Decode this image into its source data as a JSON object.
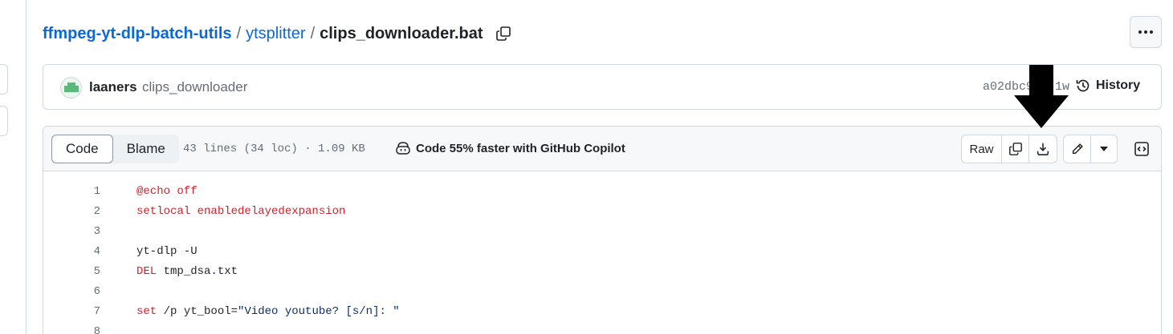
{
  "breadcrumb": {
    "repo": "ffmpeg-yt-dlp-batch-utils",
    "sep1": "/",
    "folder": "ytsplitter",
    "sep2": "/",
    "file": "clips_downloader.bat"
  },
  "commit": {
    "author": "laaners",
    "message": "clips_downloader",
    "hash": "a02dbc9 · 1w",
    "history_label": "History"
  },
  "file_header": {
    "code_tab": "Code",
    "blame_tab": "Blame",
    "meta": "43 lines (34 loc) · 1.09 KB",
    "copilot": "Code 55% faster with GitHub Copilot",
    "raw_label": "Raw"
  },
  "code_lines": [
    {
      "n": "1"
    },
    {
      "n": "2"
    },
    {
      "n": "3"
    },
    {
      "n": "4"
    },
    {
      "n": "5"
    },
    {
      "n": "6"
    },
    {
      "n": "7"
    },
    {
      "n": "8"
    }
  ],
  "code": {
    "l1": "@echo off",
    "l2": "setlocal enabledelayedexpansion",
    "l4": "yt-dlp -U",
    "l5_kw": "DEL",
    "l5_rest": " tmp_dsa.txt",
    "l7_kw": "set",
    "l7_mid": " /p yt_bool=",
    "l7_str": "\"Video youtube? [s/n]: \""
  },
  "colors": {
    "link": "#0969da",
    "keyword": "#cf222e",
    "border": "#d0d7de",
    "header_bg": "#f6f8fa"
  }
}
